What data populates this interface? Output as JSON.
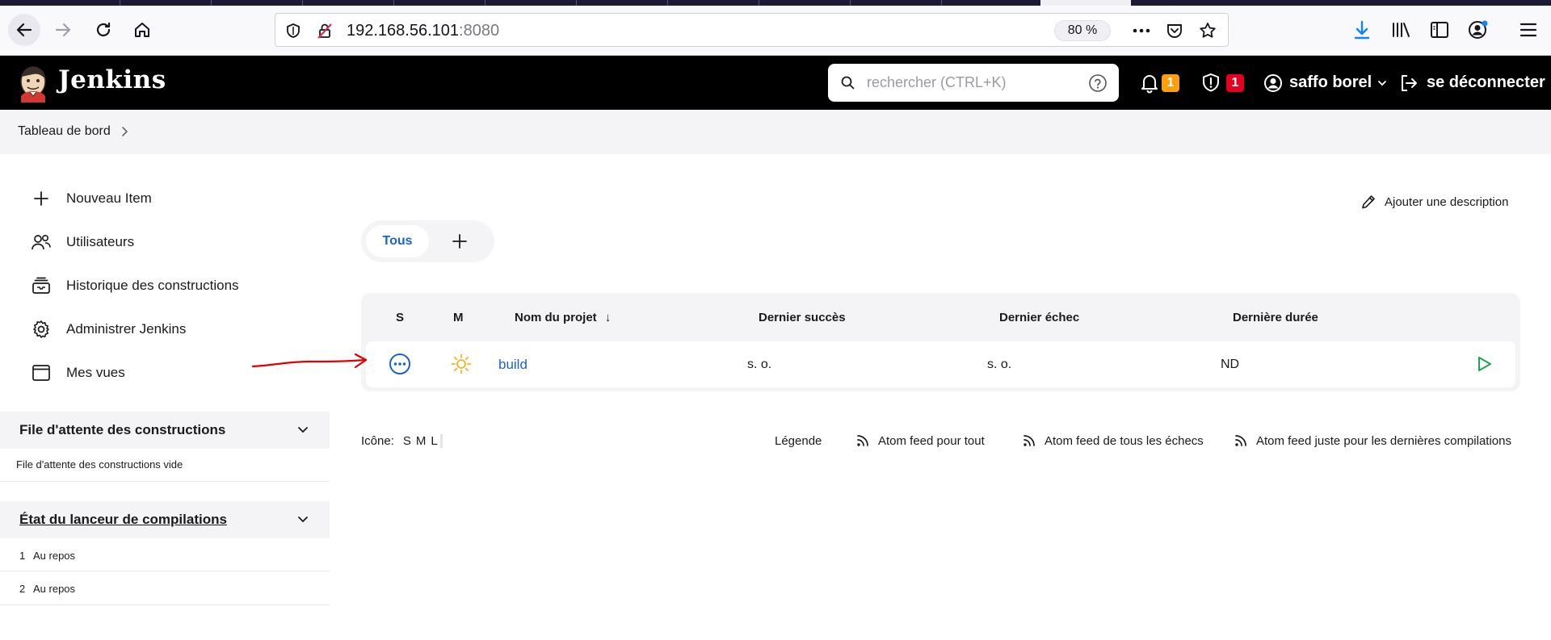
{
  "browser": {
    "url_host": "192.168.56.101",
    "url_port": ":8080",
    "zoom": "80 %"
  },
  "header": {
    "title": "Jenkins",
    "search_placeholder": "rechercher (CTRL+K)",
    "notifications_count": "1",
    "security_count": "1",
    "user_name": "saffo borel",
    "logout_label": "se déconnecter"
  },
  "breadcrumb": {
    "dashboard": "Tableau de bord"
  },
  "sidebar": {
    "tasks": [
      {
        "label": "Nouveau Item",
        "icon": "plus-icon"
      },
      {
        "label": "Utilisateurs",
        "icon": "users-icon"
      },
      {
        "label": "Historique des constructions",
        "icon": "history-icon"
      },
      {
        "label": "Administrer Jenkins",
        "icon": "gear-icon"
      },
      {
        "label": "Mes vues",
        "icon": "window-icon"
      }
    ],
    "build_queue": {
      "title": "File d'attente des constructions",
      "empty_text": "File d'attente des constructions vide"
    },
    "executors": {
      "title": "État du lanceur de compilations",
      "items": [
        {
          "number": "1",
          "status": "Au repos"
        },
        {
          "number": "2",
          "status": "Au repos"
        }
      ]
    }
  },
  "main": {
    "add_description": "Ajouter une description",
    "tabs": [
      {
        "label": "Tous",
        "active": true
      }
    ],
    "table": {
      "headers": {
        "s": "S",
        "m": "M",
        "name": "Nom du projet",
        "sort_arrow": "↓",
        "last_success": "Dernier succès",
        "last_failure": "Dernier échec",
        "last_duration": "Dernière durée"
      },
      "rows": [
        {
          "name": "build",
          "last_success": "s. o.",
          "last_failure": "s. o.",
          "last_duration": "ND",
          "status": "not-built",
          "weather": "sunny"
        }
      ]
    },
    "footer": {
      "icon_label": "Icône:",
      "sizes": [
        "S",
        "M",
        "L"
      ],
      "legend": "Légende",
      "feed_all": "Atom feed pour tout",
      "feed_failures": "Atom feed de tous les échecs",
      "feed_latest": "Atom feed juste pour les dernières compilations"
    }
  },
  "colors": {
    "jenkins_header": "#000000",
    "link_blue": "#1b64c9",
    "badge_orange": "#fe9e0f",
    "badge_red": "#e6001f",
    "run_green": "#1ea64b",
    "weather_sun": "#f0b429",
    "annotation_arrow": "#e00000"
  }
}
